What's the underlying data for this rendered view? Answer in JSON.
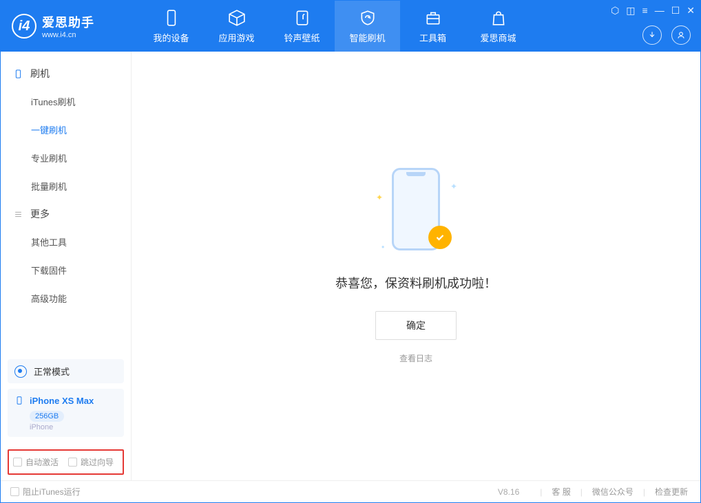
{
  "app": {
    "title": "爱思助手",
    "subtitle": "www.i4.cn"
  },
  "topTabs": {
    "device": "我的设备",
    "apps": "应用游戏",
    "ring": "铃声壁纸",
    "flash": "智能刷机",
    "tools": "工具箱",
    "store": "爱思商城"
  },
  "sidebar": {
    "section_flash": "刷机",
    "items_flash": {
      "itunes": "iTunes刷机",
      "oneclick": "一键刷机",
      "pro": "专业刷机",
      "batch": "批量刷机"
    },
    "section_more": "更多",
    "items_more": {
      "other": "其他工具",
      "firmware": "下载固件",
      "advanced": "高级功能"
    }
  },
  "mode": {
    "label": "正常模式"
  },
  "device": {
    "name": "iPhone XS Max",
    "capacity": "256GB",
    "type": "iPhone"
  },
  "options": {
    "auto_activate": "自动激活",
    "skip_guide": "跳过向导"
  },
  "main": {
    "success_text": "恭喜您，保资料刷机成功啦！",
    "ok_btn": "确定",
    "log_link": "查看日志"
  },
  "footer": {
    "block_itunes": "阻止iTunes运行",
    "version": "V8.16",
    "support": "客 服",
    "wechat": "微信公众号",
    "update": "检查更新"
  }
}
